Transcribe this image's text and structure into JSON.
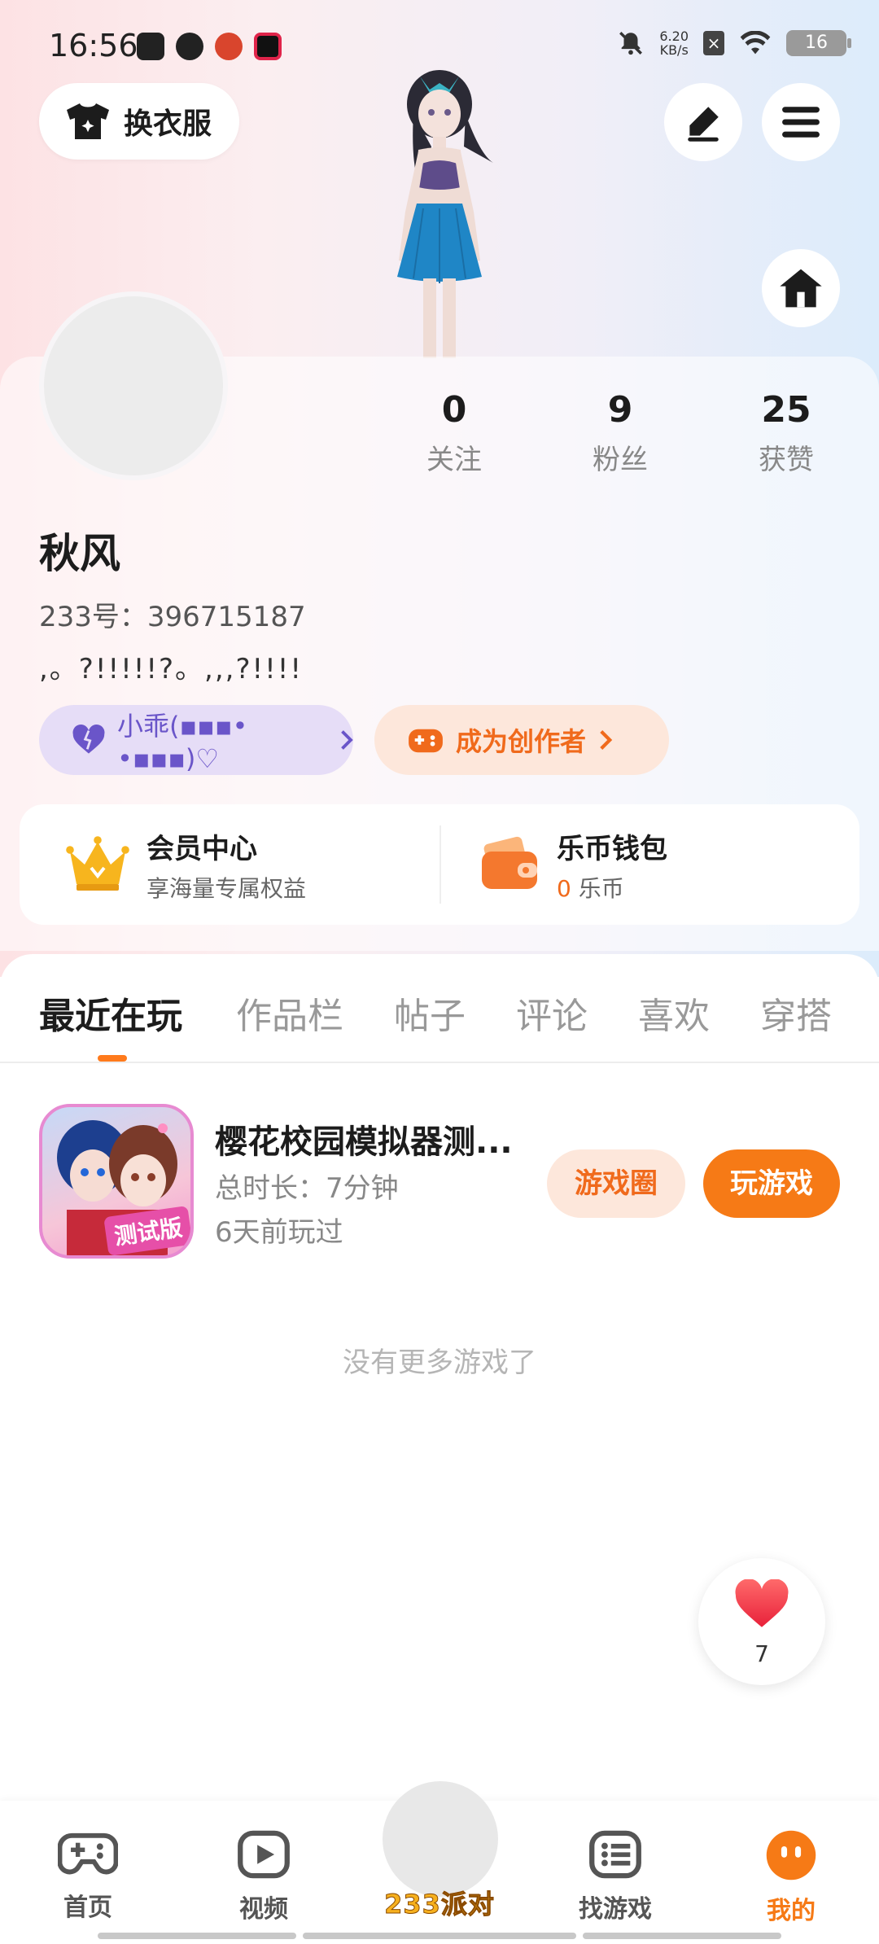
{
  "status_bar": {
    "time": "16:56",
    "net_speed_value": "6.20",
    "net_speed_unit": "KB/s",
    "battery": "16",
    "icons": [
      "notification-muted-icon",
      "wifi-icon",
      "battery-icon"
    ]
  },
  "header": {
    "outfit_label": "换衣服"
  },
  "profile": {
    "name": "秋风",
    "id_text": "233号：396715187",
    "bio": ",。?!!!!!?。,,,?!!!!",
    "stats": [
      {
        "value": "0",
        "label": "关注"
      },
      {
        "value": "9",
        "label": "粉丝"
      },
      {
        "value": "25",
        "label": "获赞"
      }
    ],
    "tag_label": "小乖(▪▪▪• •▪▪▪)♡",
    "creator_label": "成为创作者"
  },
  "member": {
    "vip_title": "会员中心",
    "vip_sub": "享海量专属权益",
    "wallet_title": "乐币钱包",
    "wallet_amount": "0",
    "wallet_unit": "乐币"
  },
  "tabs": [
    "最近在玩",
    "作品栏",
    "帖子",
    "评论",
    "喜欢",
    "穿搭"
  ],
  "recent_game": {
    "title": "樱花校园模拟器测...",
    "duration": "总时长：7分钟",
    "last_played": "6天前玩过",
    "icon_tag": "测试版",
    "circle_label": "游戏圈",
    "play_label": "玩游戏"
  },
  "no_more_text": "没有更多游戏了",
  "like_count": "7",
  "bottom_nav": [
    {
      "label": "首页",
      "icon": "gamepad-icon"
    },
    {
      "label": "视频",
      "icon": "video-play-icon"
    },
    {
      "label": "233派对",
      "icon": "party-center-icon"
    },
    {
      "label": "找游戏",
      "icon": "list-icon"
    },
    {
      "label": "我的",
      "icon": "profile-face-icon"
    }
  ],
  "colors": {
    "accent": "#f67a16",
    "purple": "#6a55c9"
  }
}
